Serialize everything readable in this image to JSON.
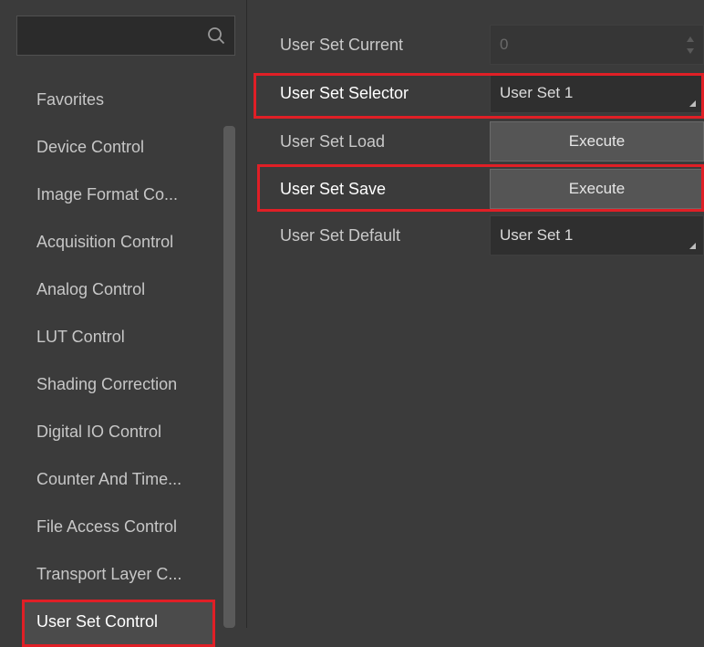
{
  "search": {
    "placeholder": ""
  },
  "sidebar": {
    "items": [
      {
        "label": "Favorites"
      },
      {
        "label": "Device Control"
      },
      {
        "label": "Image Format Co..."
      },
      {
        "label": "Acquisition Control"
      },
      {
        "label": "Analog Control"
      },
      {
        "label": "LUT Control"
      },
      {
        "label": "Shading Correction"
      },
      {
        "label": "Digital IO Control"
      },
      {
        "label": "Counter And Time..."
      },
      {
        "label": "File Access Control"
      },
      {
        "label": "Transport Layer C..."
      },
      {
        "label": "User Set Control"
      }
    ],
    "active_item": "User Set Control"
  },
  "properties": {
    "user_set_current": {
      "label": "User Set Current",
      "value": "0"
    },
    "user_set_selector": {
      "label": "User Set Selector",
      "value": "User Set 1"
    },
    "user_set_load": {
      "label": "User Set Load",
      "button": "Execute"
    },
    "user_set_save": {
      "label": "User Set Save",
      "button": "Execute"
    },
    "user_set_default": {
      "label": "User Set Default",
      "value": "User Set 1"
    }
  },
  "colors": {
    "highlight": "#e01f26",
    "background": "#3b3b3b",
    "button": "#555555"
  }
}
